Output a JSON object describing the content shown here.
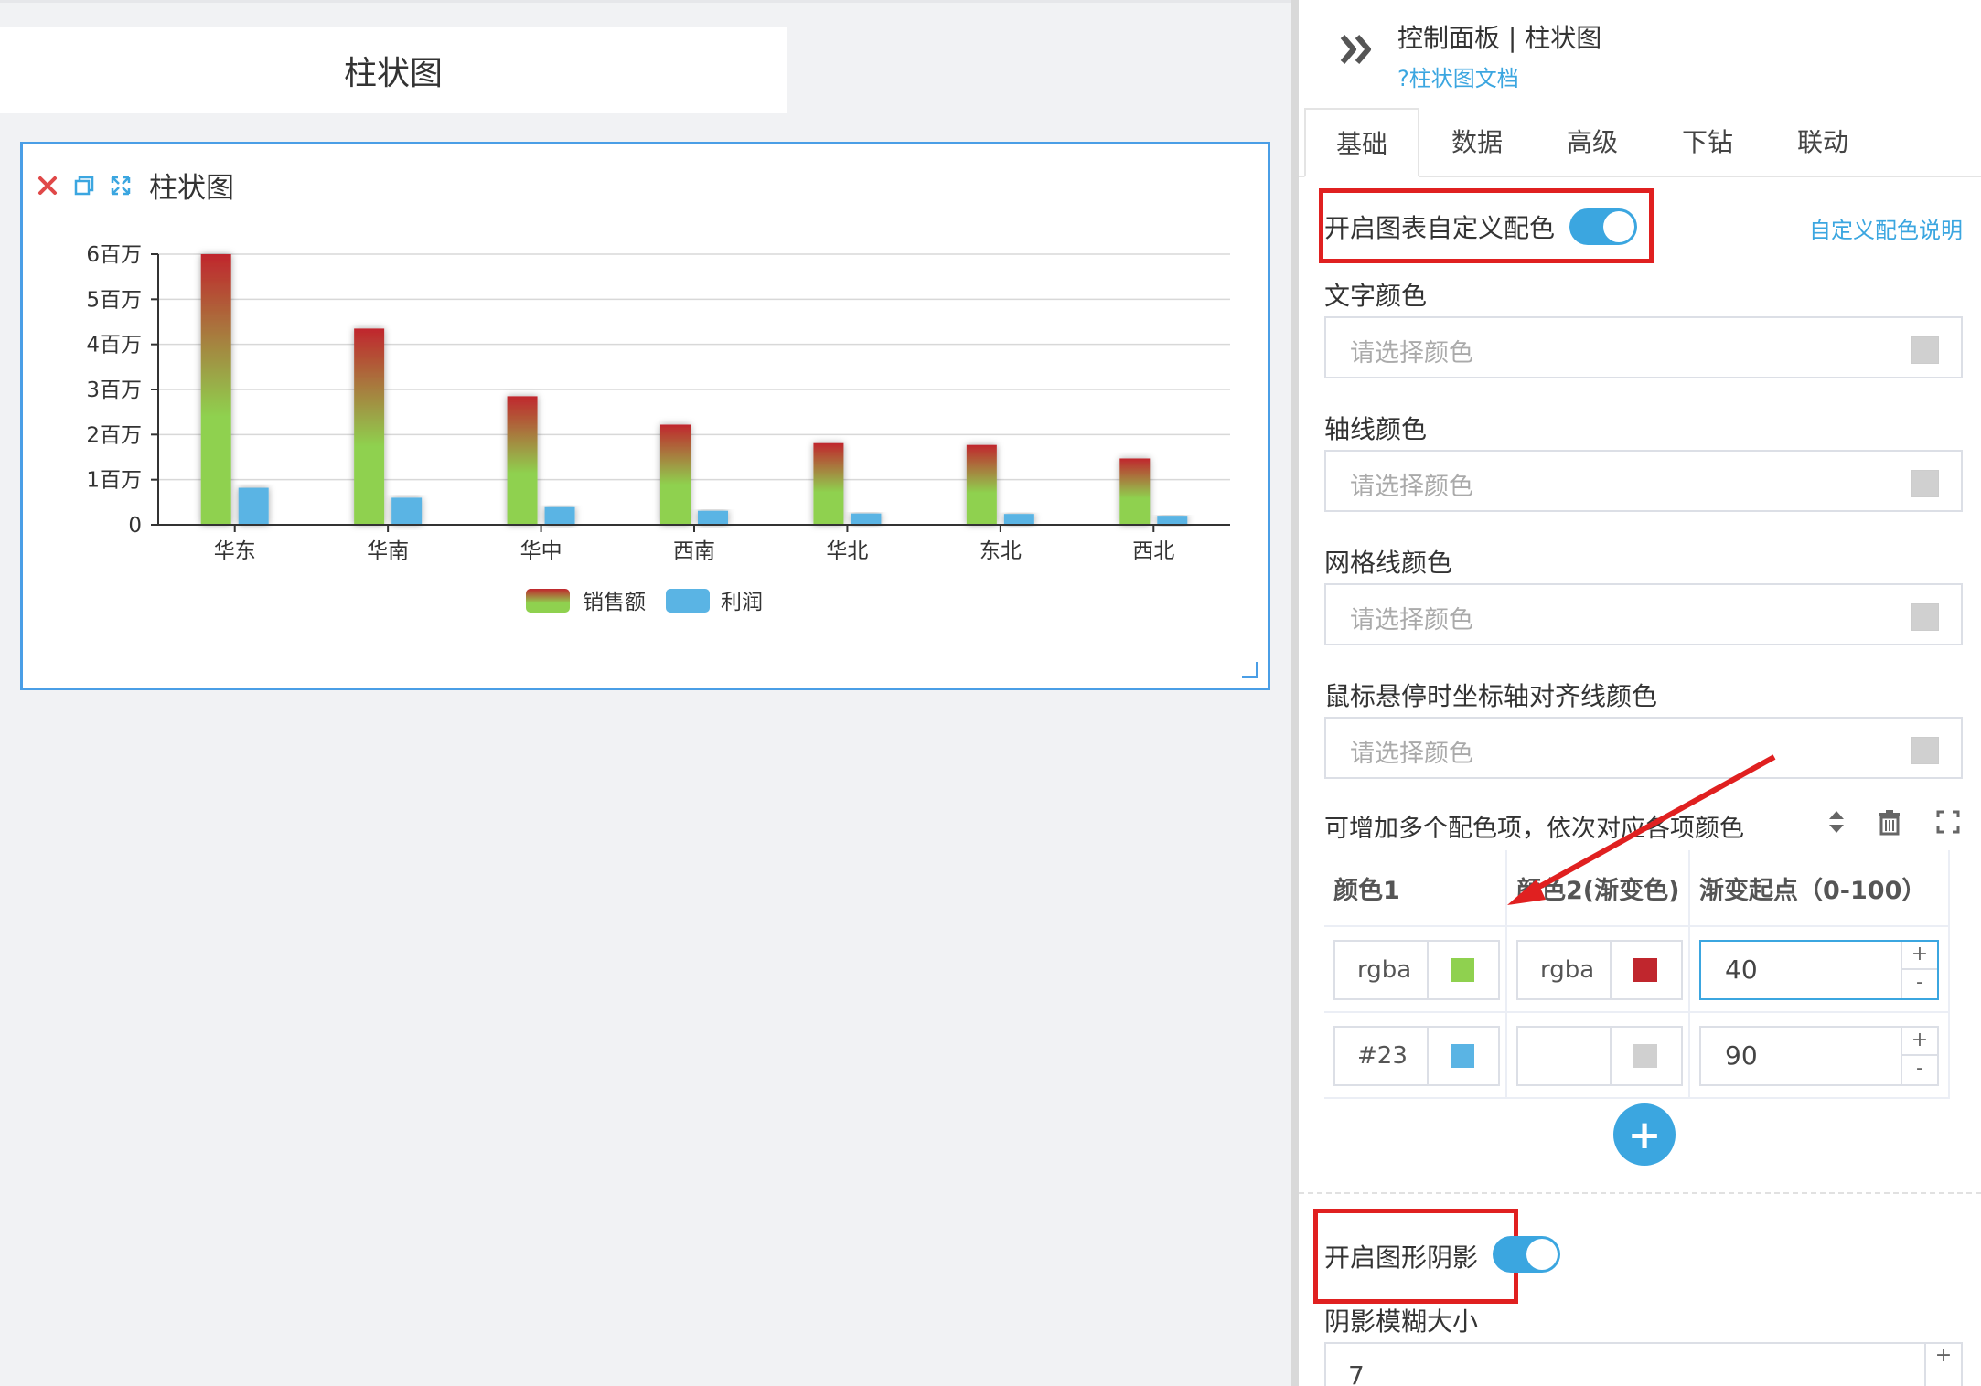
{
  "canvas": {
    "title_card_text": "柱状图",
    "widget": {
      "title": "柱状图",
      "icons": [
        "close-icon",
        "copy-icon",
        "expand-icon"
      ]
    }
  },
  "chart_data": {
    "type": "bar",
    "title": "",
    "categories": [
      "华东",
      "华南",
      "华中",
      "西南",
      "华北",
      "东北",
      "西北"
    ],
    "series": [
      {
        "name": "销售额",
        "values": [
          6000000,
          4350000,
          2850000,
          2220000,
          1810000,
          1770000,
          1470000
        ],
        "gradient": [
          "#8fd14f",
          "#c0262d"
        ]
      },
      {
        "name": "利润",
        "values": [
          820000,
          600000,
          390000,
          310000,
          250000,
          240000,
          200000
        ],
        "color": "#5ab4e4"
      }
    ],
    "yticks": [
      "0",
      "1百万",
      "2百万",
      "3百万",
      "4百万",
      "5百万",
      "6百万"
    ],
    "ylim": [
      0,
      6000000
    ],
    "grid": true,
    "legend_position": "bottom"
  },
  "panel": {
    "header_title": "控制面板 | 柱状图",
    "doc_link": "?柱状图文档",
    "tabs": [
      "基础",
      "数据",
      "高级",
      "下钻",
      "联动"
    ],
    "active_tab": "基础",
    "custom_color": {
      "label": "开启图表自定义配色",
      "enabled": true,
      "help_link": "自定义配色说明"
    },
    "text_color": {
      "label": "文字颜色",
      "placeholder": "请选择颜色"
    },
    "axis_color": {
      "label": "轴线颜色",
      "placeholder": "请选择颜色"
    },
    "grid_color": {
      "label": "网格线颜色",
      "placeholder": "请选择颜色"
    },
    "hover_color": {
      "label": "鼠标悬停时坐标轴对齐线颜色",
      "placeholder": "请选择颜色"
    },
    "multi_label": "可增加多个配色项，依次对应各项颜色",
    "table": {
      "headers": [
        "颜色1",
        "颜色2(渐变色)",
        "渐变起点（0-100）"
      ],
      "rows": [
        {
          "c1_text": "rgba",
          "c1_swatch": "#8fd14f",
          "c2_text": "rgba",
          "c2_swatch": "#c0262d",
          "start": "40"
        },
        {
          "c1_text": "#23",
          "c1_swatch": "#5ab4e4",
          "c2_text": "",
          "c2_swatch": "#d0d0d0",
          "start": "90"
        }
      ],
      "step_up": "+",
      "step_down": "-"
    },
    "add_button": "+",
    "shadow": {
      "label": "开启图形阴影",
      "enabled": true
    },
    "shadow_blur": {
      "label": "阴影模糊大小",
      "value": "7"
    }
  }
}
